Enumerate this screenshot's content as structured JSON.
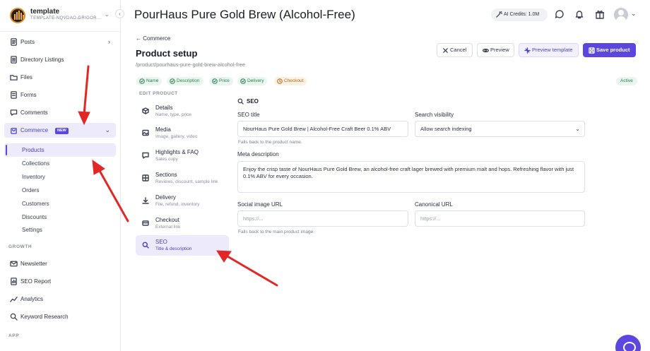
{
  "brand": {
    "name": "template",
    "subtitle": "TEMPLATE-NQVDAO.GRIGOR..."
  },
  "sidebar": {
    "items": [
      {
        "label": "Posts"
      },
      {
        "label": "Directory Listings"
      },
      {
        "label": "Files"
      },
      {
        "label": "Forms"
      },
      {
        "label": "Comments"
      },
      {
        "label": "Commerce",
        "badge": "NEW"
      }
    ],
    "commerce_sub": [
      "Products",
      "Collections",
      "Inventory",
      "Orders",
      "Customers",
      "Discounts",
      "Settings"
    ],
    "growth_heading": "GROWTH",
    "growth_items": [
      "Newsletter",
      "SEO Report",
      "Analytics",
      "Keyword Research"
    ],
    "app_heading": "APP"
  },
  "header": {
    "title": "PourHaus Pure Gold Brew (Alcohol-Free)",
    "ai_credits": "AI Credits: 1.0M"
  },
  "content": {
    "back_label": "Commerce",
    "page_title": "Product setup",
    "path": "/product/pourhaus-pure-gold-brew-alcohol-free",
    "buttons": {
      "cancel": "Cancel",
      "preview": "Preview",
      "preview_template": "Preview template",
      "save": "Save product"
    },
    "status_chips": [
      "Name",
      "Description",
      "Price",
      "Delivery",
      "Checkout"
    ],
    "status": "Active",
    "edit_heading": "EDIT PRODUCT",
    "steps": [
      {
        "title": "Details",
        "sub": "Name, type, price"
      },
      {
        "title": "Media",
        "sub": "Image, gallery, video"
      },
      {
        "title": "Highlights & FAQ",
        "sub": "Sales copy"
      },
      {
        "title": "Sections",
        "sub": "Reviews, discount, sample link"
      },
      {
        "title": "Delivery",
        "sub": "File, refund, inventory"
      },
      {
        "title": "Checkout",
        "sub": "External link"
      },
      {
        "title": "SEO",
        "sub": "Title & description"
      }
    ]
  },
  "seo": {
    "heading": "SEO",
    "title_label": "SEO title",
    "title_value": "NourHaus Pure Gold Brew | Alcohol-Free Craft Beer 0.1% ABV",
    "title_hint": "Falls back to the product name.",
    "visibility_label": "Search visibility",
    "visibility_value": "Allow search indexing",
    "meta_label": "Meta description",
    "meta_value": "Enjoy the crisp taste of NourHaus Pure Gold Brew, an alcohol-free craft lager brewed with premium malt and hops. Refreshing flavor with just 0.1% ABV for every occasion.",
    "social_label": "Social image URL",
    "social_placeholder": "https://...",
    "social_hint": "Falls back to the main product image.",
    "canonical_label": "Canonical URL",
    "canonical_placeholder": "https://..."
  },
  "colors": {
    "accent": "#5b47e0",
    "annotation_arrow": "#e32626",
    "success": "#2e7d52",
    "warning": "#b8660f"
  }
}
